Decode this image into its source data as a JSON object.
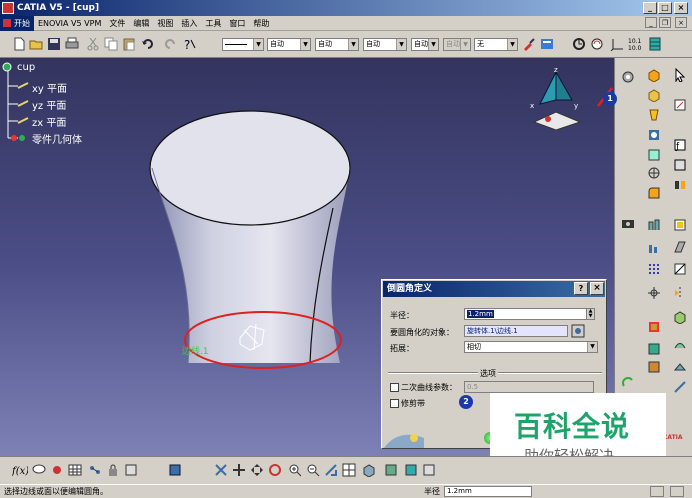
{
  "window": {
    "title": "CATIA V5 - [cup]",
    "min": "_",
    "max": "□",
    "close": "×"
  },
  "menu": {
    "items": [
      "开始",
      "ENOVIA V5 VPM",
      "文件",
      "编辑",
      "视图",
      "插入",
      "工具",
      "窗口",
      "帮助"
    ]
  },
  "toolbar": {
    "line_type": "",
    "color": "自动",
    "thickness": "自动",
    "linetype2": "自动",
    "layer": "自动",
    "style": "自动",
    "extra": "自动",
    "render": "无"
  },
  "tree": {
    "root": "cup",
    "items": [
      "xy 平面",
      "yz 平面",
      "zx 平面",
      "零件几何体"
    ]
  },
  "model": {
    "label": "边线.1"
  },
  "axes": {
    "x": "x",
    "y": "y",
    "z": "z"
  },
  "dialog": {
    "title": "倒圆角定义",
    "radius_label": "半径：",
    "radius_value": "1.2mm",
    "objects_label": "要圆角化的对象：",
    "objects_value": "旋转体.1\\边线.1",
    "propagation_label": "拓展：",
    "propagation_value": "相切",
    "options_header": "选项",
    "conic_label": "二次曲线参数：",
    "conic_value": "0.5",
    "trim_label": "修剪带",
    "marker2": "2"
  },
  "marker1": "1",
  "status": {
    "message": "选择边线或面以便编辑圆角。",
    "param_label": "半径",
    "param_value": "1.2mm"
  },
  "watermark": {
    "title": "百科全说",
    "subtitle": "助你轻松解决"
  },
  "brand": "CATIA"
}
